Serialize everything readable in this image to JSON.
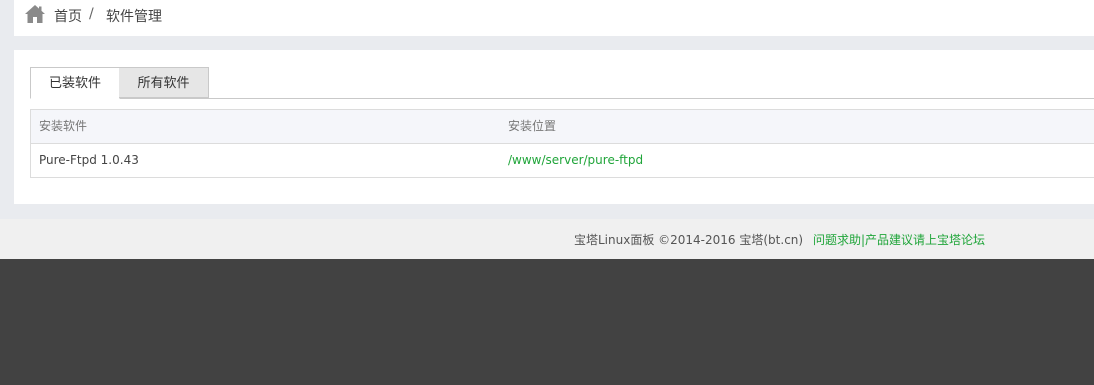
{
  "breadcrumb": {
    "home": "首页",
    "separator": "/",
    "current": "软件管理"
  },
  "tabs": [
    {
      "label": "已装软件",
      "active": true
    },
    {
      "label": "所有软件",
      "active": false
    }
  ],
  "table": {
    "headers": [
      "安装软件",
      "安装位置"
    ],
    "rows": [
      {
        "name": "Pure-Ftpd 1.0.43",
        "path": "/www/server/pure-ftpd"
      }
    ]
  },
  "footer": {
    "copyright": "宝塔Linux面板 ©2014-2016 宝塔(bt.cn)",
    "link": "问题求助|产品建议请上宝塔论坛"
  },
  "colors": {
    "accent": "#20a53a",
    "page_bg": "#e9ebef",
    "footer_bg": "#f0f0f0",
    "dark_bg": "#424242"
  },
  "icons": {
    "home": "home-icon"
  }
}
